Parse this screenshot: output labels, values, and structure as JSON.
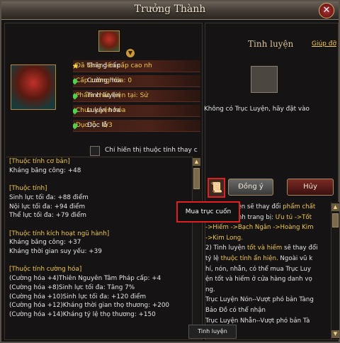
{
  "window": {
    "title": "Trưởng Thành",
    "close_label": "✕"
  },
  "left": {
    "attrs": [
      {
        "icon": "star-icon",
        "label": "Thăng cấp",
        "value": "Đã tăng đến cấp cao nh"
      },
      {
        "icon": "green-diamond-icon",
        "label": "Cường hóa",
        "value": "Cấp cường hóa: 0"
      },
      {
        "icon": "green-diamond-icon",
        "label": "Tinh luyện",
        "value": "Phẩm chất hiện tại: Sử"
      },
      {
        "icon": "green-diamond-icon",
        "label": "Luyện hóa",
        "value": "Chưa luyện hóa"
      },
      {
        "icon": "green-diamond-icon",
        "label": "Đục lỗ",
        "value": "Đục lỗ : 0/3"
      }
    ],
    "checkbox_label": "Chỉ hiển thị thuộc tính thay c",
    "lines": [
      {
        "text": "[Thuộc tính cơ bản]",
        "head": true
      },
      {
        "text": "Kháng băng công: +48",
        "head": false
      },
      {
        "text": "",
        "head": false
      },
      {
        "text": "[Thuộc tính]",
        "head": true
      },
      {
        "text": "Sinh lực tối đa: +88 điểm",
        "head": false
      },
      {
        "text": "Nội lực tối đa: +94 điểm",
        "head": false
      },
      {
        "text": "Thể lực tối đa: +79 điểm",
        "head": false
      },
      {
        "text": "",
        "head": false
      },
      {
        "text": "[Thuộc tính kích hoạt ngũ hành]",
        "head": true
      },
      {
        "text": "Kháng băng công: +37",
        "head": false
      },
      {
        "text": "Kháng thời gian suy yếu: +39",
        "head": false
      },
      {
        "text": "",
        "head": false
      },
      {
        "text": "[Thuộc tính cường hóa]",
        "head": true
      },
      {
        "text": "(Cường hóa +4)Thiên Nguyên Tâm Pháp cấp: +4",
        "head": false
      },
      {
        "text": "(Cường hóa +8)Sinh lực tối đa: Tăng 7%",
        "head": false
      },
      {
        "text": "(Cường hóa +10)Sinh lực tối đa: +120 điểm",
        "head": false
      },
      {
        "text": "(Cường hóa +12)Kháng thời gian thọ thương: +200",
        "head": false
      },
      {
        "text": "(Cường hóa +14)Kháng tỷ lệ thọ thương: +150",
        "head": false
      }
    ]
  },
  "right": {
    "title": "Tinh luyện",
    "help_label": "Giúp đỡ",
    "empty_note": "Không có Trục Luyện, hãy đặt vào",
    "ok_label": "Đồng ý",
    "cancel_label": "Hủy",
    "tooltip": "Mua trục cuốn",
    "mini_tooltip": "Tinh luyện",
    "desc_lines": [
      {
        "parts": [
          {
            "t": "1) Tinh luyện sẽ thay đổi ",
            "c": ""
          },
          {
            "t": "phẩm chất",
            "c": "y"
          }
        ]
      },
      {
        "parts": [
          {
            "t": "và thuộc tính trang bị: ",
            "c": ""
          },
          {
            "t": "Ưu tú ->Tốt",
            "c": "y"
          }
        ]
      },
      {
        "parts": [
          {
            "t": "->Hiếm ->Bạch Ngân ->Hoàng Kim",
            "c": "y"
          }
        ]
      },
      {
        "parts": [
          {
            "t": "->Kim Long.",
            "c": "y"
          }
        ]
      },
      {
        "parts": [
          {
            "t": "2) Tinh luyện ",
            "c": ""
          },
          {
            "t": "tốt và hiếm",
            "c": "y"
          },
          {
            "t": " sẽ thay đổi",
            "c": ""
          }
        ]
      },
      {
        "parts": [
          {
            "t": "tỷ lệ ",
            "c": ""
          },
          {
            "t": "thuộc tính ẩn hiện.",
            "c": "y"
          },
          {
            "t": " Ngoài vũ k",
            "c": ""
          }
        ]
      },
      {
        "parts": [
          {
            "t": "hí, nón, nhẫn, có thể mua Trục Luy",
            "c": ""
          }
        ]
      },
      {
        "parts": [
          {
            "t": "ện tốt và hiếm ở cửa hàng danh vọ",
            "c": ""
          }
        ]
      },
      {
        "parts": [
          {
            "t": "ng.",
            "c": ""
          }
        ]
      },
      {
        "parts": [
          {
            "t": "Trục Luyện Nón--Vượt phó bản Tàng",
            "c": ""
          }
        ]
      },
      {
        "parts": [
          {
            "t": "Bảo Đồ có thể nhận",
            "c": ""
          }
        ]
      },
      {
        "parts": [
          {
            "t": "Trục Luyện Nhẫn--Vượt phó bản Tà",
            "c": ""
          }
        ]
      }
    ]
  }
}
